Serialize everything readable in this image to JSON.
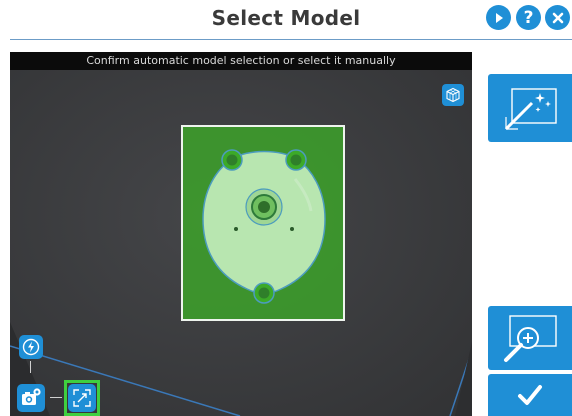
{
  "header": {
    "title": "Select Model",
    "help_label": "?"
  },
  "camera_view": {
    "instruction": "Confirm automatic model selection or select it manually"
  },
  "colors": {
    "accent": "#1f8fd6",
    "selection_fill": "#3caa28",
    "selected_tool_frame": "#3fcf3f"
  },
  "icons": {
    "play": "play-icon",
    "help": "help-icon",
    "close": "close-icon",
    "view3d": "cube-icon",
    "magic_wand": "magic-wand-icon",
    "zoom": "zoom-in-icon",
    "confirm": "checkmark-icon",
    "flash": "flash-icon",
    "camera_settings": "camera-settings-icon",
    "fit": "fit-to-view-icon"
  }
}
